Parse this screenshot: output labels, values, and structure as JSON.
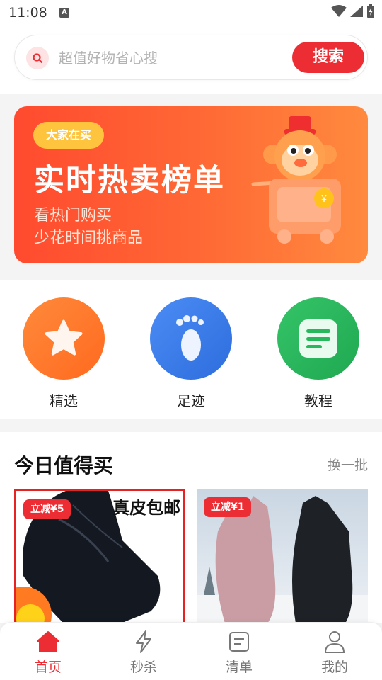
{
  "status_bar": {
    "time": "11:08",
    "notification_letter": "A"
  },
  "search": {
    "placeholder": "超值好物省心搜",
    "button_label": "搜索"
  },
  "banner": {
    "badge": "大家在买",
    "title": "实时热卖榜单",
    "subtitle_line1": "看热门购买",
    "subtitle_line2": "少花时间挑商品",
    "coin_symbol": "¥"
  },
  "categories": [
    {
      "label": "精选",
      "icon": "star-icon",
      "color": "#ff7a2a"
    },
    {
      "label": "足迹",
      "icon": "footprint-icon",
      "color": "#3b7de8"
    },
    {
      "label": "教程",
      "icon": "document-icon",
      "color": "#28b85c"
    }
  ],
  "today": {
    "title": "今日值得买",
    "refresh_label": "换一批",
    "products": [
      {
        "discount": "立减¥5",
        "overlay_text": "真皮包邮"
      },
      {
        "discount": "立减¥1"
      }
    ]
  },
  "tabbar": {
    "items": [
      {
        "label": "首页",
        "icon": "home-icon",
        "active": true
      },
      {
        "label": "秒杀",
        "icon": "lightning-icon",
        "active": false
      },
      {
        "label": "清单",
        "icon": "list-icon",
        "active": false
      },
      {
        "label": "我的",
        "icon": "person-icon",
        "active": false
      }
    ]
  },
  "colors": {
    "accent": "#ec2d33",
    "badge": "#ffc43d"
  }
}
